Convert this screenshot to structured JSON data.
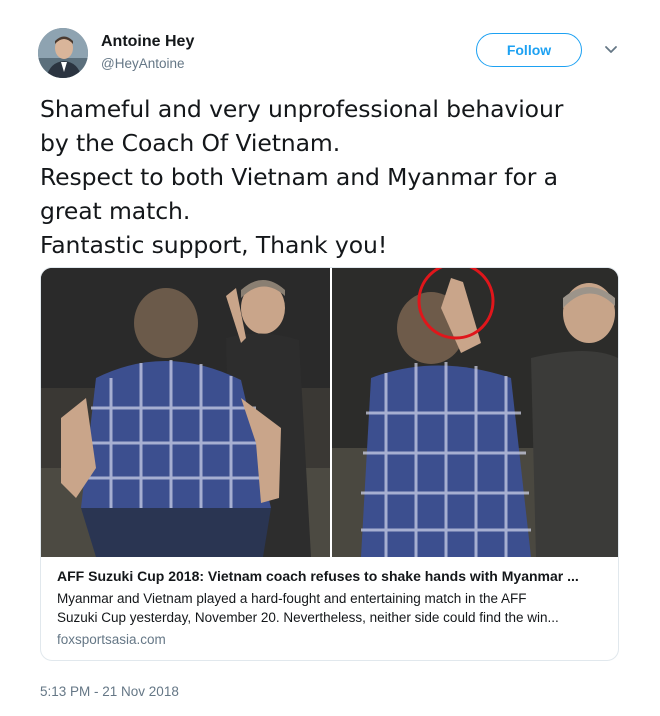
{
  "author": {
    "name": "Antoine Hey",
    "handle": "@HeyAntoine"
  },
  "follow_label": "Follow",
  "tweet": {
    "lines": [
      "Shameful and very unprofessional  behaviour",
      "by the Coach Of Vietnam.",
      "Respect to both Vietnam and Myanmar for a",
      "great match.",
      "Fantastic support, Thank you!"
    ]
  },
  "card": {
    "title": "AFF Suzuki Cup 2018: Vietnam coach refuses to shake hands with Myanmar ...",
    "description_lines": [
      "Myanmar and Vietnam played a hard-fought and entertaining match in the AFF",
      "Suzuki Cup yesterday, November 20. Nevertheless, neither side could find the win..."
    ],
    "domain": "foxsportsasia.com"
  },
  "timestamp": "5:13 PM - 21 Nov 2018",
  "colors": {
    "accent": "#1da1f2",
    "secondary_text": "#657786",
    "annotation_circle": "#e0161b"
  },
  "icons": {
    "menu": "chevron-down-icon"
  }
}
